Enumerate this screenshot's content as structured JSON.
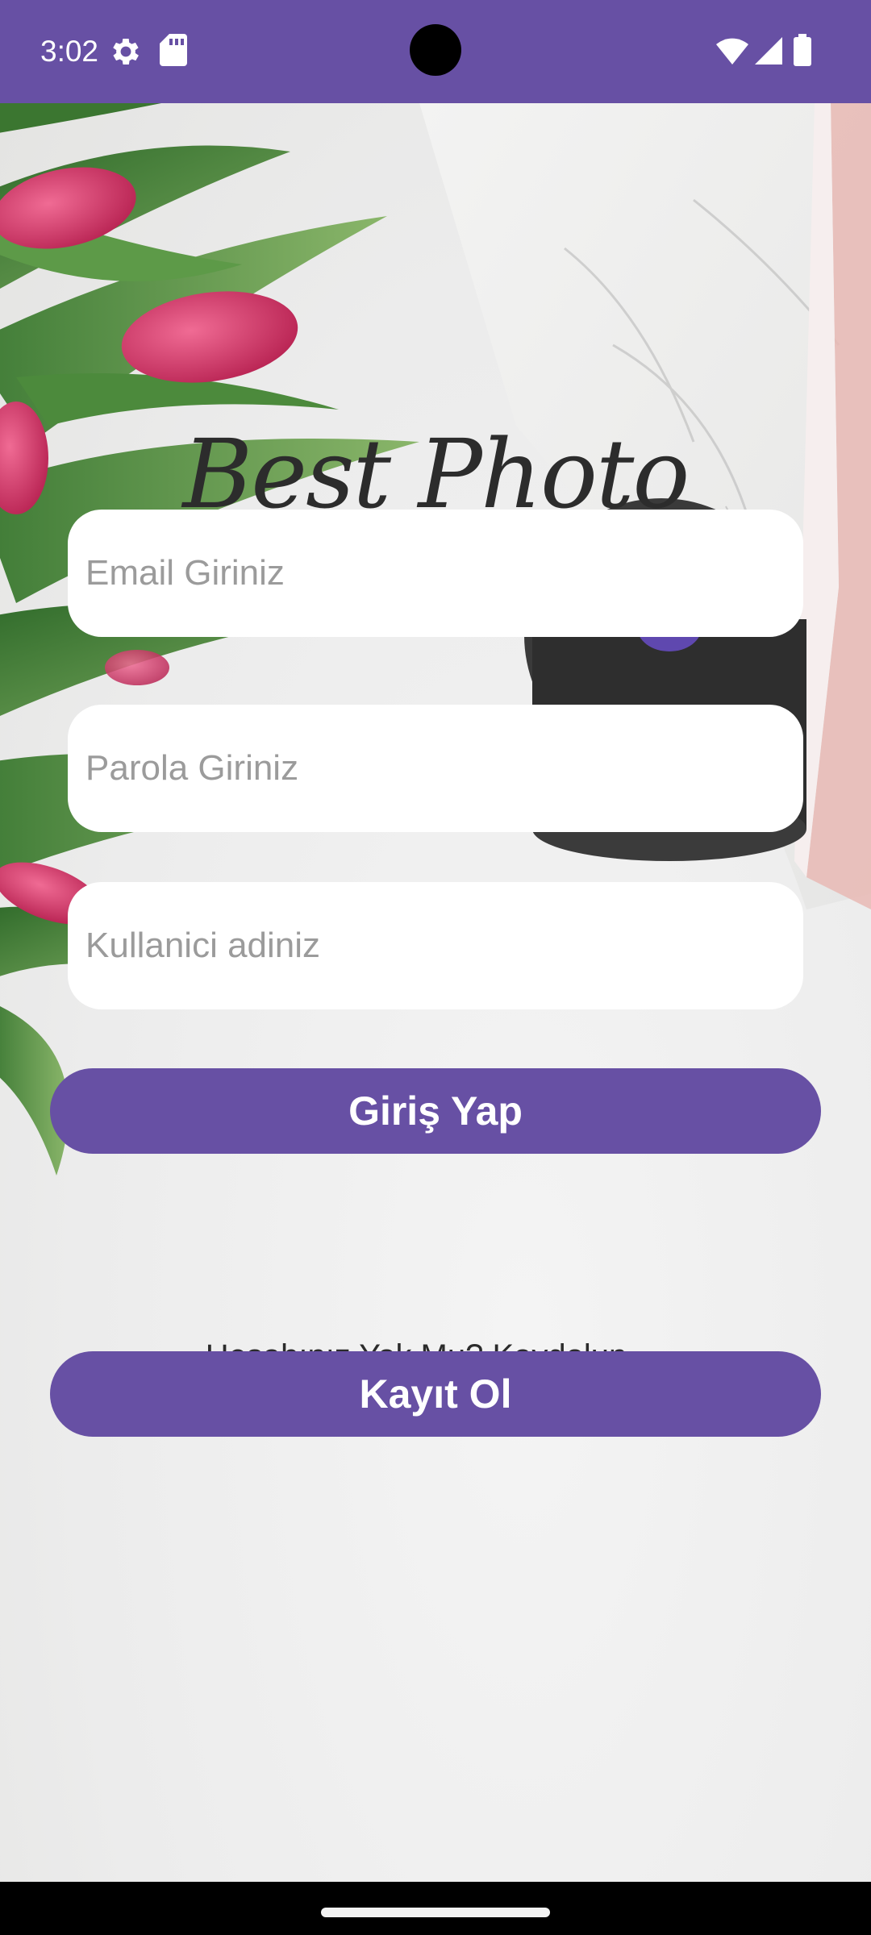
{
  "status_bar": {
    "time": "3:02",
    "left_icons": [
      "settings-gear-icon",
      "sd-card-icon"
    ],
    "right_icons": [
      "wifi-icon",
      "cellular-signal-icon",
      "battery-icon"
    ],
    "color": "#6750a4"
  },
  "app": {
    "logo_text": "Best Photo",
    "accent_color": "#6750a4"
  },
  "form": {
    "email": {
      "placeholder": "Email Giriniz",
      "value": ""
    },
    "password": {
      "placeholder": "Parola Giriniz",
      "value": ""
    },
    "username": {
      "placeholder": "Kullanici adiniz",
      "value": ""
    }
  },
  "actions": {
    "login_label": "Giriş Yap",
    "signup_prompt": "Hesabınız Yok Mu? Kaydolun",
    "register_label": "Kayıt Ol"
  }
}
